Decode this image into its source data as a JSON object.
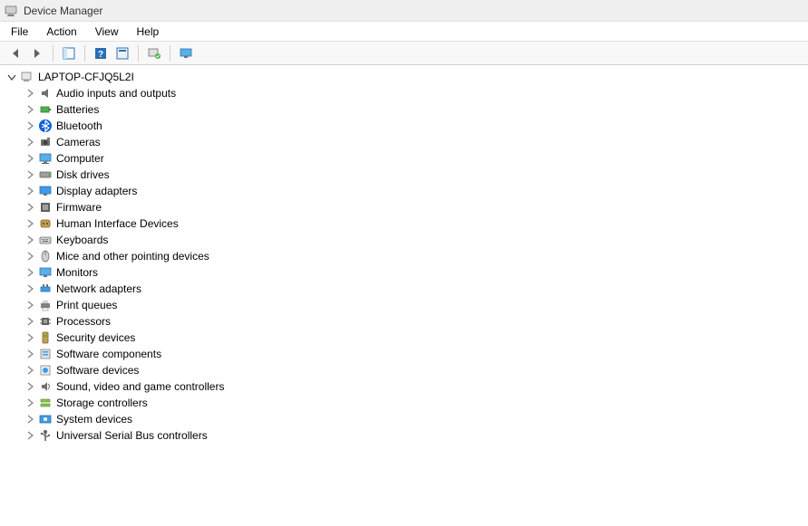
{
  "window": {
    "title": "Device Manager"
  },
  "menubar": {
    "file": "File",
    "action": "Action",
    "view": "View",
    "help": "Help"
  },
  "tree": {
    "root": {
      "label": "LAPTOP-CFJQ5L2I",
      "expanded": true
    },
    "categories": [
      {
        "label": "Audio inputs and outputs",
        "icon": "speaker"
      },
      {
        "label": "Batteries",
        "icon": "battery"
      },
      {
        "label": "Bluetooth",
        "icon": "bluetooth"
      },
      {
        "label": "Cameras",
        "icon": "camera"
      },
      {
        "label": "Computer",
        "icon": "computer"
      },
      {
        "label": "Disk drives",
        "icon": "disk"
      },
      {
        "label": "Display adapters",
        "icon": "display"
      },
      {
        "label": "Firmware",
        "icon": "firmware"
      },
      {
        "label": "Human Interface Devices",
        "icon": "hid"
      },
      {
        "label": "Keyboards",
        "icon": "keyboard"
      },
      {
        "label": "Mice and other pointing devices",
        "icon": "mouse"
      },
      {
        "label": "Monitors",
        "icon": "monitor"
      },
      {
        "label": "Network adapters",
        "icon": "network"
      },
      {
        "label": "Print queues",
        "icon": "printer"
      },
      {
        "label": "Processors",
        "icon": "cpu"
      },
      {
        "label": "Security devices",
        "icon": "security"
      },
      {
        "label": "Software components",
        "icon": "software"
      },
      {
        "label": "Software devices",
        "icon": "softdev"
      },
      {
        "label": "Sound, video and game controllers",
        "icon": "sound"
      },
      {
        "label": "Storage controllers",
        "icon": "storage"
      },
      {
        "label": "System devices",
        "icon": "system"
      },
      {
        "label": "Universal Serial Bus controllers",
        "icon": "usb"
      }
    ]
  }
}
